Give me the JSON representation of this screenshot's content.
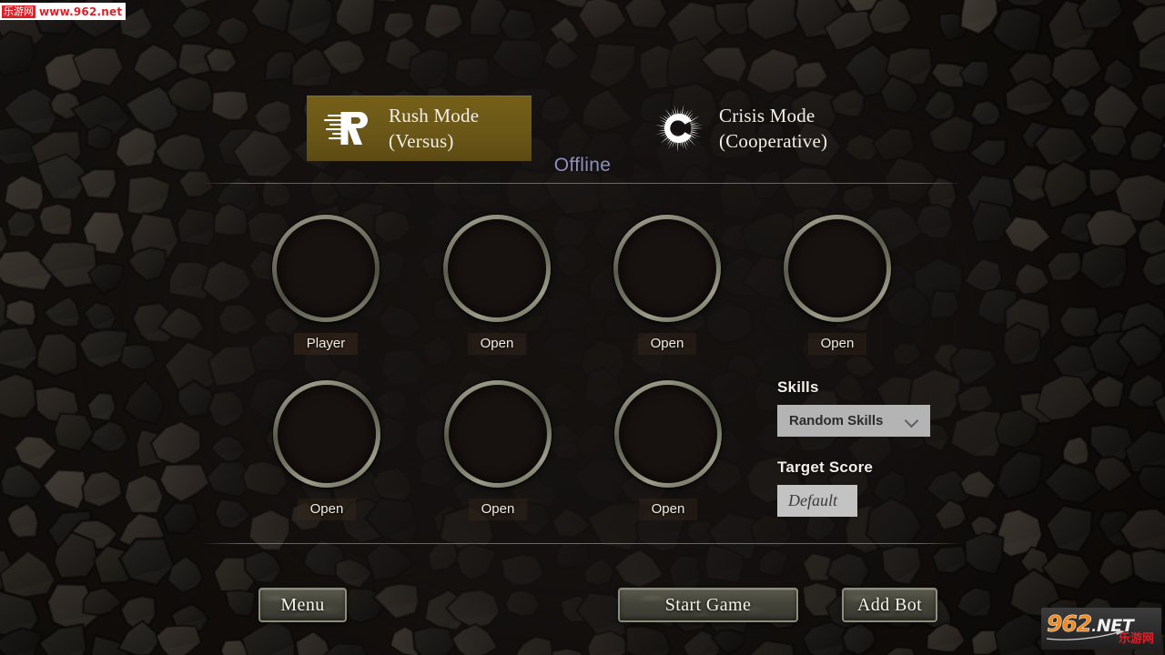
{
  "modes": [
    {
      "id": "rush",
      "icon": "rush-speed-r-icon",
      "line1": "Rush Mode",
      "line2": "(Versus)",
      "selected": true,
      "color": "#6b5717"
    },
    {
      "id": "crisis",
      "icon": "crisis-sunburst-c-icon",
      "line1": "Crisis Mode",
      "line2": "(Cooperative)",
      "selected": false,
      "color": "#ffffff"
    }
  ],
  "status": {
    "connection": "Offline",
    "color": "#8e8fba"
  },
  "slots": [
    {
      "label": "Player",
      "state": "filled",
      "avatar": "dwarf-portrait"
    },
    {
      "label": "Open",
      "state": "open",
      "avatar": null
    },
    {
      "label": "Open",
      "state": "open",
      "avatar": null
    },
    {
      "label": "Open",
      "state": "open",
      "avatar": null
    },
    {
      "label": "Open",
      "state": "open",
      "avatar": null
    },
    {
      "label": "Open",
      "state": "open",
      "avatar": null
    },
    {
      "label": "Open",
      "state": "open",
      "avatar": null
    }
  ],
  "options": {
    "skills": {
      "title": "Skills",
      "value": "Random Skills",
      "icon": "chevron-down-icon"
    },
    "target_score": {
      "title": "Target Score",
      "value": "Default",
      "placeholder": "Default"
    }
  },
  "actions": {
    "menu": "Menu",
    "start_game": "Start Game",
    "add_bot": "Add Bot"
  },
  "watermark": {
    "top_badge": "乐游网",
    "top_url": "www.962.net",
    "logo_number": "962",
    "logo_dot": ".",
    "logo_net": "NET",
    "logo_cn": "乐游网"
  }
}
